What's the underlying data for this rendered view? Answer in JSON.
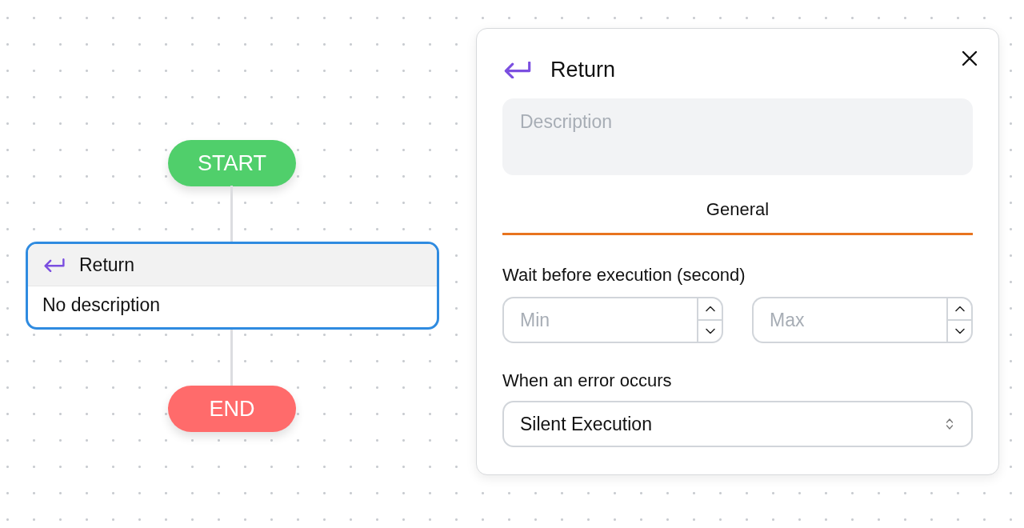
{
  "canvas": {
    "nodes": [
      {
        "kind": "start",
        "label": "START"
      },
      {
        "kind": "block",
        "title": "Return",
        "description": "No description",
        "selected": true
      },
      {
        "kind": "end",
        "label": "END"
      }
    ]
  },
  "panel": {
    "title": "Return",
    "description": {
      "placeholder": "Description"
    },
    "tabs": [
      {
        "label": "General",
        "selected": true
      }
    ],
    "wait": {
      "label": "Wait before execution (second)",
      "min": {
        "placeholder": "Min"
      },
      "max": {
        "placeholder": "Max"
      }
    },
    "error": {
      "label": "When an error occurs",
      "value": "Silent Execution"
    }
  }
}
